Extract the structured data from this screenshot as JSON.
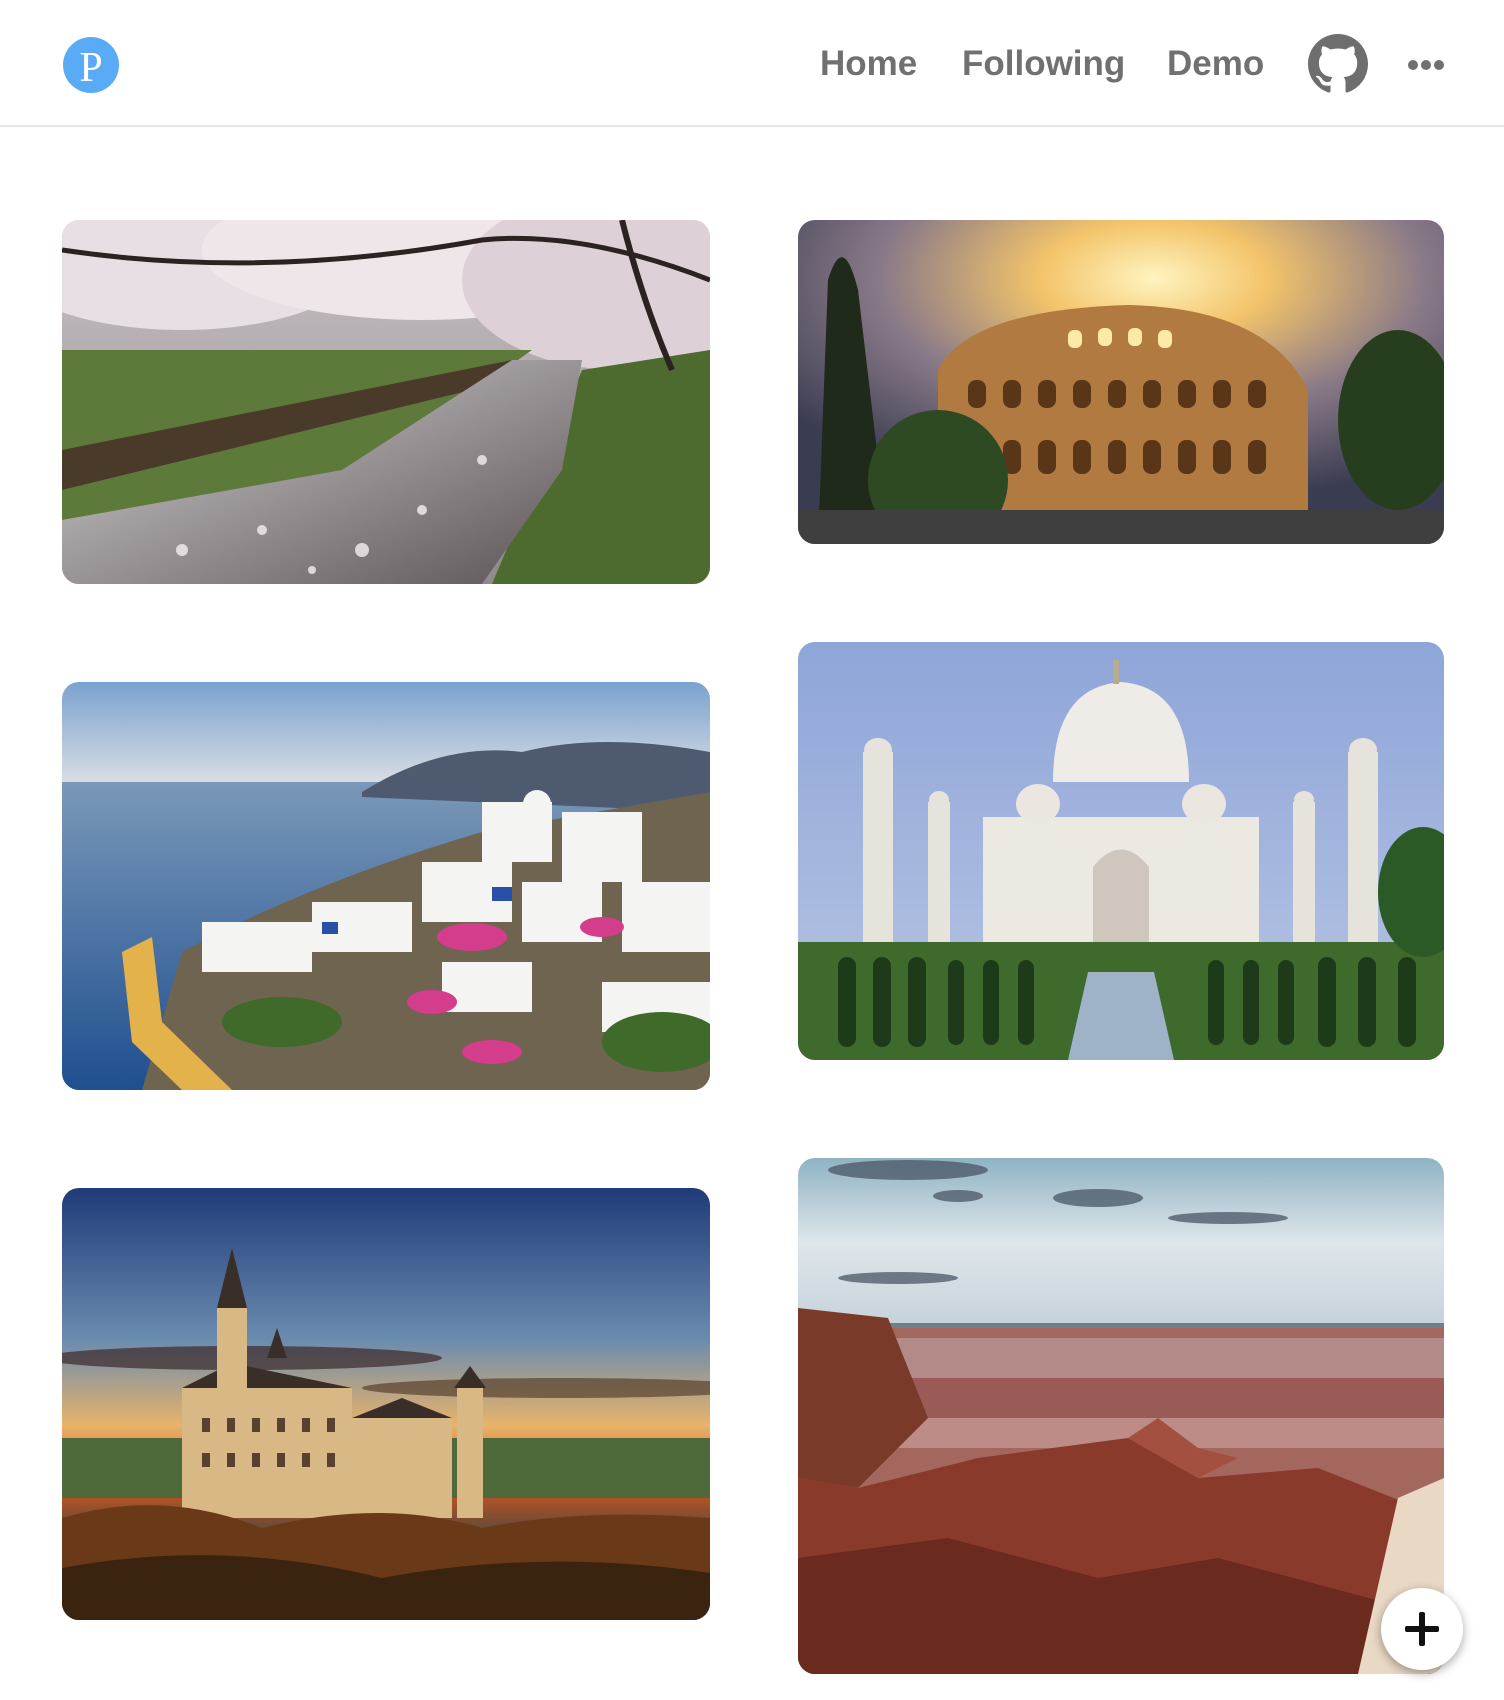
{
  "header": {
    "logo_letter": "P",
    "nav": {
      "home": "Home",
      "following": "Following",
      "demo": "Demo"
    },
    "icons": {
      "logo": "pin-logo-icon",
      "github": "github-icon",
      "more": "more-horizontal-icon"
    }
  },
  "feed": {
    "pins": [
      {
        "subject": "cherry-blossom-canal"
      },
      {
        "subject": "colosseum"
      },
      {
        "subject": "santorini"
      },
      {
        "subject": "taj-mahal"
      },
      {
        "subject": "neuschwanstein-castle"
      },
      {
        "subject": "grand-canyon"
      }
    ]
  },
  "fab": {
    "icon": "plus-icon"
  },
  "colors": {
    "brand": "#5aabf5",
    "nav_text": "#707070",
    "divider": "#e6e6e6"
  }
}
